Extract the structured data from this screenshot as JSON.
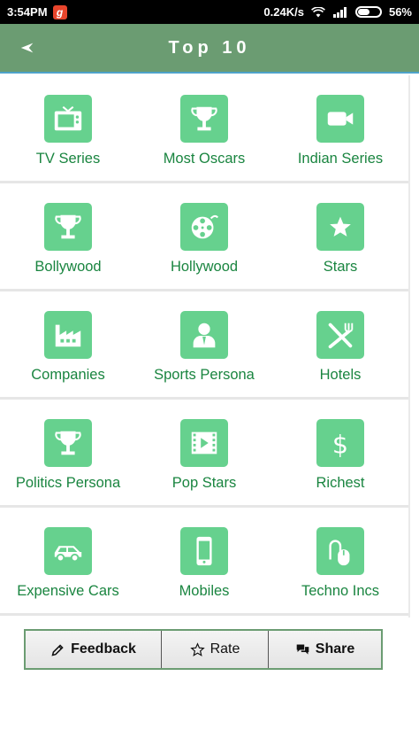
{
  "status_bar": {
    "time": "3:54PM",
    "app_badge": "g",
    "speed": "0.24K/s",
    "battery": "56%",
    "battery_level": 0.56
  },
  "app_bar": {
    "title": "Top 10"
  },
  "categories": [
    {
      "label": "TV Series",
      "icon": "tv-icon"
    },
    {
      "label": "Most Oscars",
      "icon": "trophy-icon"
    },
    {
      "label": "Indian Series",
      "icon": "video-camera-icon"
    },
    {
      "label": "Bollywood",
      "icon": "trophy-icon"
    },
    {
      "label": "Hollywood",
      "icon": "film-reel-icon"
    },
    {
      "label": "Stars",
      "icon": "star-icon"
    },
    {
      "label": "Companies",
      "icon": "factory-icon"
    },
    {
      "label": "Sports Persona",
      "icon": "person-icon"
    },
    {
      "label": "Hotels",
      "icon": "fork-knife-icon"
    },
    {
      "label": "Politics Persona",
      "icon": "trophy-icon"
    },
    {
      "label": "Pop Stars",
      "icon": "film-play-icon"
    },
    {
      "label": "Richest",
      "icon": "dollar-icon"
    },
    {
      "label": "Expensive Cars",
      "icon": "car-icon"
    },
    {
      "label": "Mobiles",
      "icon": "mobile-icon"
    },
    {
      "label": "Techno Incs",
      "icon": "mouse-icon"
    }
  ],
  "actions": {
    "feedback": "Feedback",
    "rate": "Rate",
    "share": "Share"
  },
  "colors": {
    "app_bar": "#6b9c72",
    "tile": "#66d18e",
    "label": "#1a8540"
  }
}
